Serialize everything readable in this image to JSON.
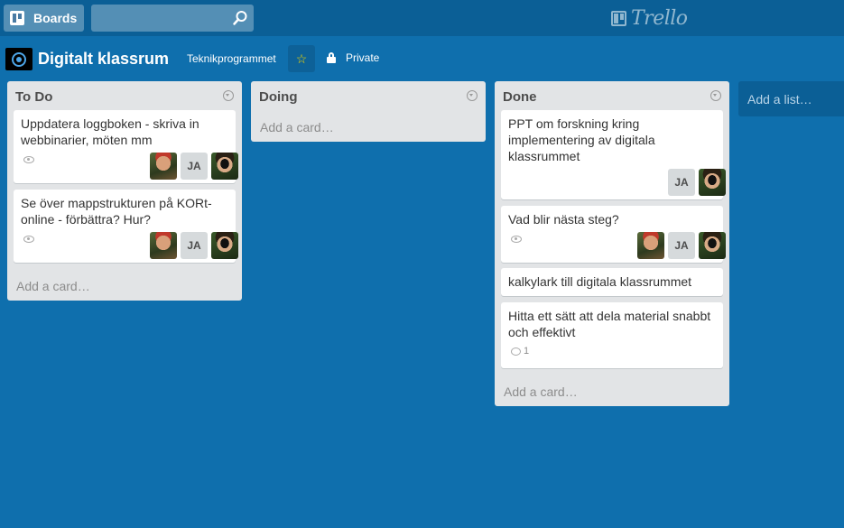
{
  "header": {
    "boards_label": "Boards",
    "search_value": "",
    "search_placeholder": "",
    "logo_text": "Trello"
  },
  "board": {
    "title": "Digitalt klassrum",
    "organization": "Teknikprogrammet",
    "privacy": "Private",
    "starred": true
  },
  "lists": [
    {
      "title": "To Do",
      "add_card": "Add a card…",
      "cards": [
        {
          "title": "Uppdatera loggboken - skriva in webbinarier, möten mm",
          "watched": true,
          "members": [
            "photo-red-hair",
            "JA",
            "photo-sunglasses"
          ]
        },
        {
          "title": "Se över mappstrukturen på KORt-online - förbättra? Hur?",
          "watched": true,
          "members": [
            "photo-red-hair",
            "JA",
            "photo-sunglasses"
          ]
        }
      ]
    },
    {
      "title": "Doing",
      "add_card": "Add a card…",
      "cards": []
    },
    {
      "title": "Done",
      "add_card": "Add a card…",
      "cards": [
        {
          "title": "PPT om forskning kring implementering av digitala klassrummet",
          "members": [
            "JA",
            "photo-sunglasses"
          ]
        },
        {
          "title": "Vad blir nästa steg?",
          "watched": true,
          "members": [
            "photo-red-hair",
            "JA",
            "photo-sunglasses"
          ]
        },
        {
          "title": "kalkylark till digitala klassrummet"
        },
        {
          "title": "Hitta ett sätt att dela material snabbt och effektivt",
          "comments": "1"
        }
      ]
    }
  ],
  "add_list": "Add a list…",
  "member_initials": "JA",
  "colors": {
    "board_background": "#0f6fad",
    "header_background": "#0b5f96",
    "list_background": "#e2e4e6",
    "star": "#f2d600"
  }
}
